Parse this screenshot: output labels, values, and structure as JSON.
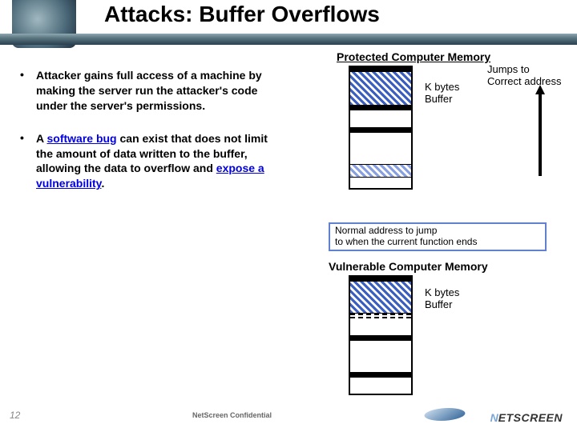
{
  "title": "Attacks: Buffer Overflows",
  "bullets": [
    {
      "pre": "Attacker gains full access of a machine by making the server run the attacker's code under the server's permissions."
    },
    {
      "pre": "A ",
      "l1": "software bug",
      "mid": " can exist that does not limit the amount of data written to the buffer, allowing the data to overflow and ",
      "l2": "expose a vulnerability",
      "post": "."
    }
  ],
  "diag": {
    "protected_title": "Protected Computer Memory",
    "vulnerable_title": "Vulnerable Computer Memory",
    "jumps": "Jumps to\nCorrect address",
    "kbytes": "K bytes\nBuffer",
    "callout": "Normal address to jump\nto when the current function ends"
  },
  "footer": {
    "page": "12",
    "conf": "NetScreen Confidential",
    "logo1": "N",
    "logo2": "ETSCREEN"
  }
}
